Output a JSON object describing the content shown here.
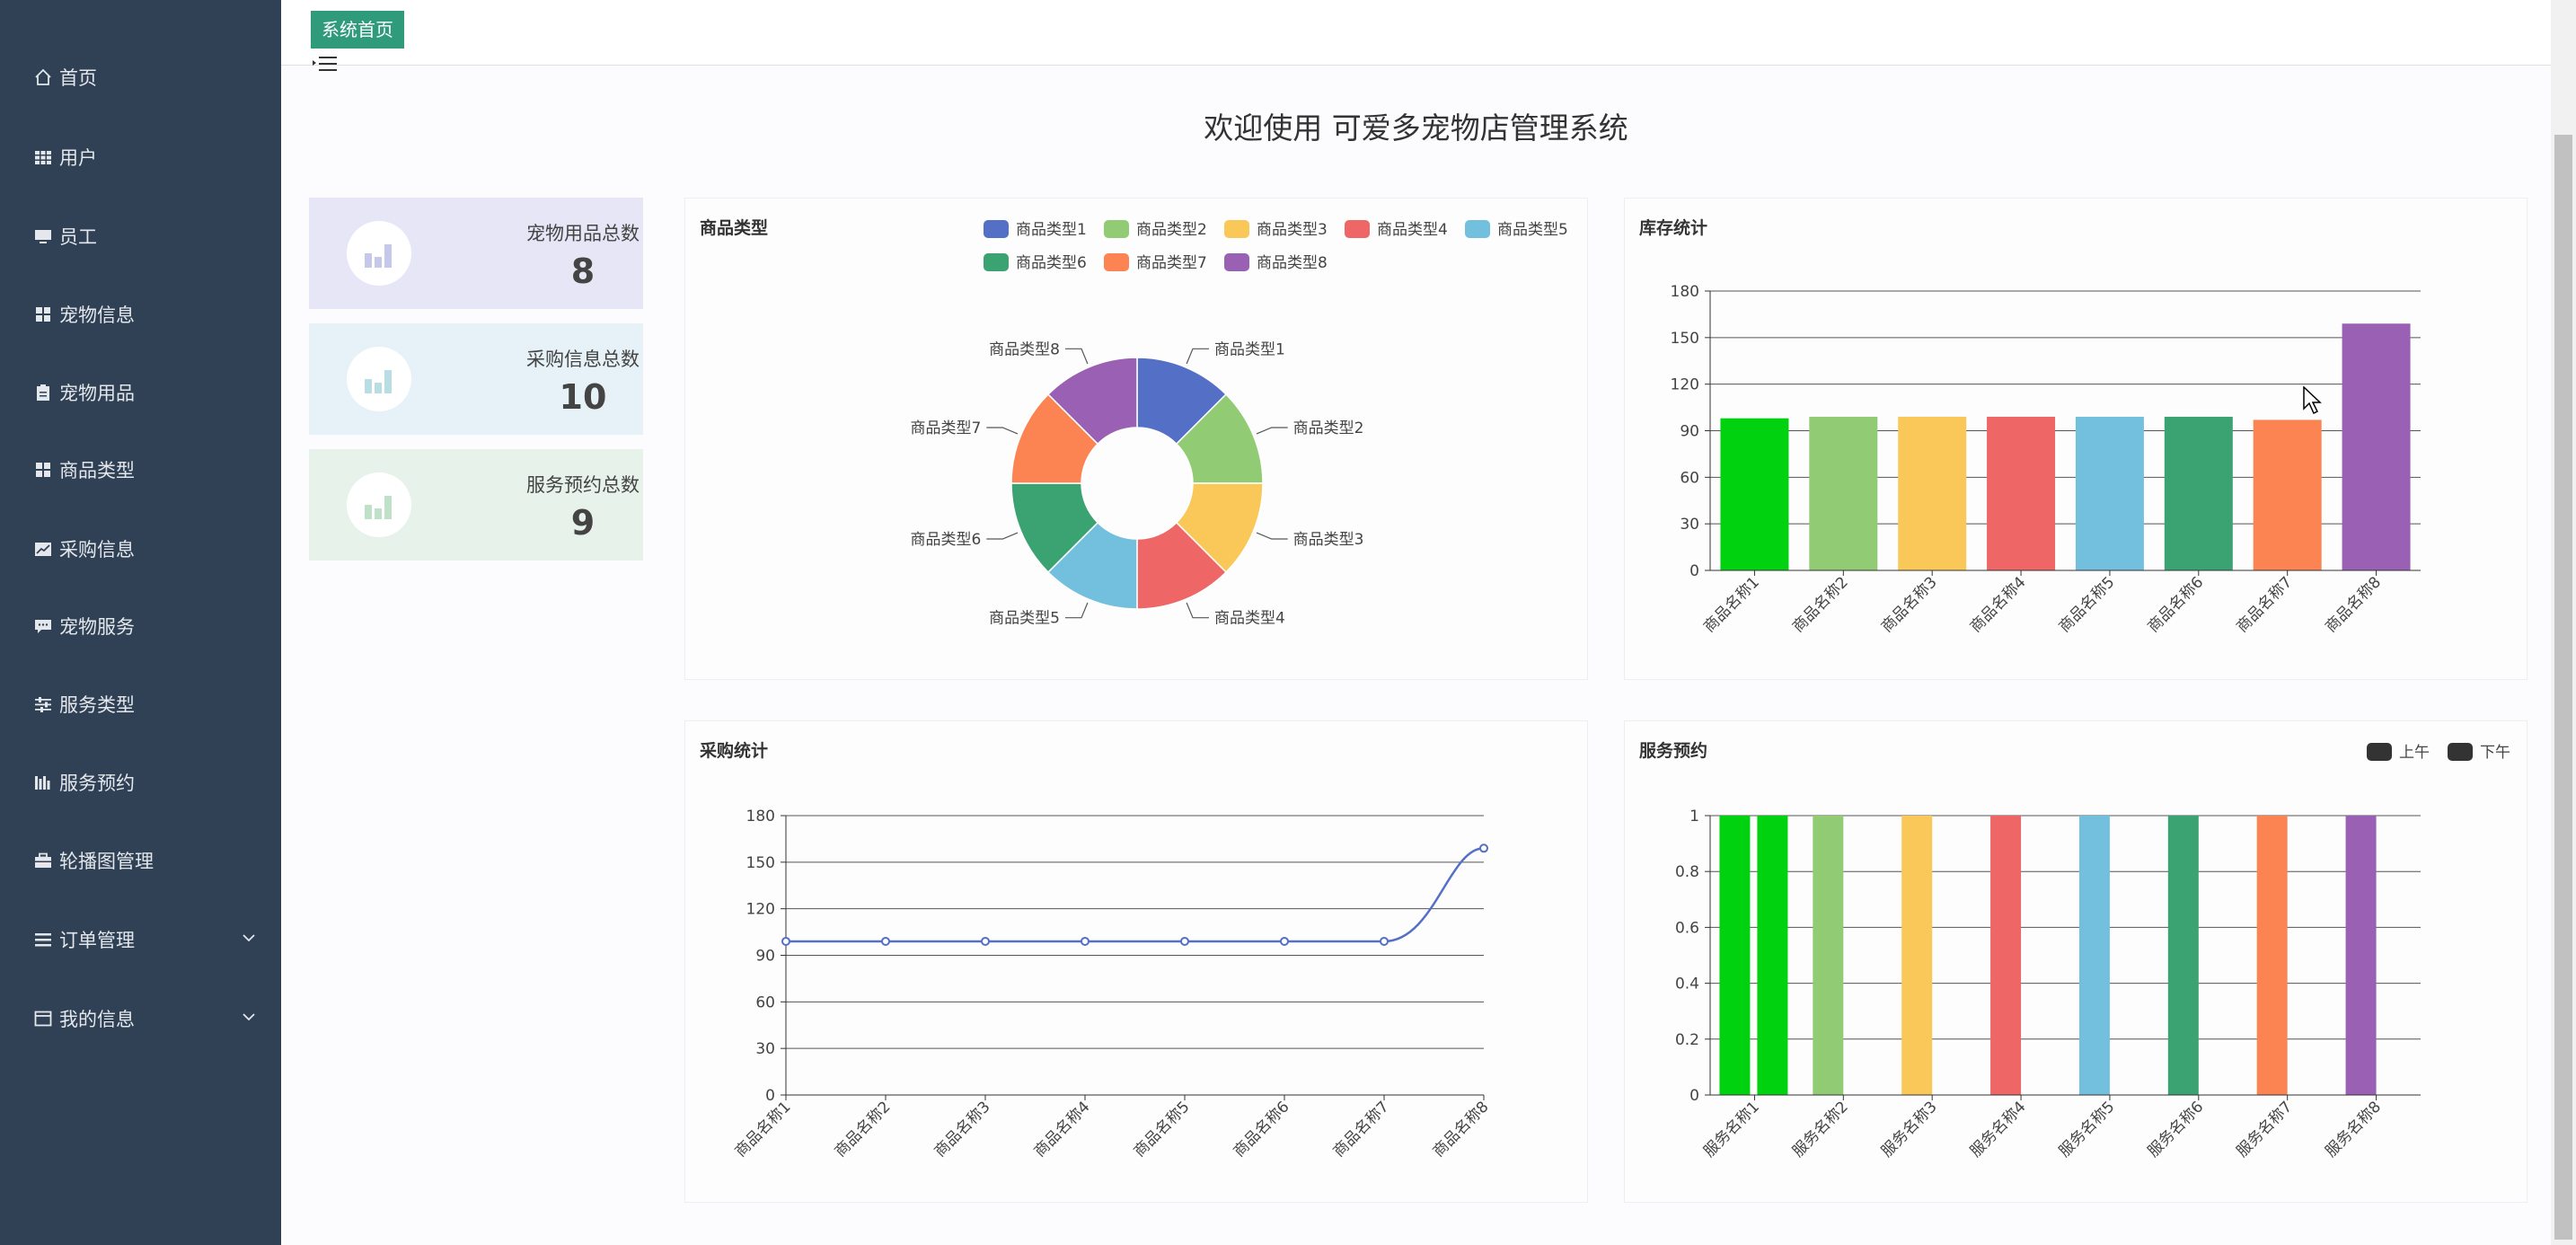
{
  "sidebar": {
    "items": [
      {
        "label": "首页",
        "icon": "home-icon"
      },
      {
        "label": "用户",
        "icon": "grid-icon"
      },
      {
        "label": "员工",
        "icon": "monitor-icon"
      },
      {
        "label": "宠物信息",
        "icon": "apps-icon"
      },
      {
        "label": "宠物用品",
        "icon": "clipboard-icon"
      },
      {
        "label": "商品类型",
        "icon": "apps-icon"
      },
      {
        "label": "采购信息",
        "icon": "chart-icon"
      },
      {
        "label": "宠物服务",
        "icon": "chat-icon"
      },
      {
        "label": "服务类型",
        "icon": "sliders-icon"
      },
      {
        "label": "服务预约",
        "icon": "bars-icon"
      },
      {
        "label": "轮播图管理",
        "icon": "briefcase-icon"
      },
      {
        "label": "订单管理",
        "icon": "menu-icon"
      },
      {
        "label": "我的信息",
        "icon": "window-icon"
      }
    ]
  },
  "header": {
    "tab_home": "系统首页"
  },
  "welcome": "欢迎使用 可爱多宠物店管理系统",
  "stats": [
    {
      "label": "宠物用品总数",
      "value": "8",
      "bg": "#e6e6f7",
      "icon_color": "#c6c8ea"
    },
    {
      "label": "采购信息总数",
      "value": "10",
      "bg": "#e6f2f7",
      "icon_color": "#b8dde3"
    },
    {
      "label": "服务预约总数",
      "value": "9",
      "bg": "#e7f2ea",
      "icon_color": "#bfe0c9"
    }
  ],
  "colors": {
    "palette": [
      "#5470c6",
      "#91cc75",
      "#fac858",
      "#ee6666",
      "#73c0de",
      "#3ba272",
      "#fc8452",
      "#9a60b4"
    ],
    "first_bar": "#00d20f"
  },
  "charts": {
    "pie_title": "商品类型",
    "stock_title": "库存统计",
    "purchase_title": "采购统计",
    "service_title": "服务预约"
  },
  "chart_data": [
    {
      "type": "pie",
      "title": "商品类型",
      "categories": [
        "商品类型1",
        "商品类型2",
        "商品类型3",
        "商品类型4",
        "商品类型5",
        "商品类型6",
        "商品类型7",
        "商品类型8"
      ],
      "values": [
        1,
        1,
        1,
        1,
        1,
        1,
        1,
        1
      ],
      "legend": "top-right"
    },
    {
      "type": "bar",
      "title": "库存统计",
      "categories": [
        "商品名称1",
        "商品名称2",
        "商品名称3",
        "商品名称4",
        "商品名称5",
        "商品名称6",
        "商品名称7",
        "商品名称8"
      ],
      "values": [
        98,
        99,
        99,
        99,
        99,
        99,
        97,
        159
      ],
      "ylim": [
        0,
        180
      ],
      "yticks": [
        0,
        30,
        60,
        90,
        120,
        150,
        180
      ]
    },
    {
      "type": "line",
      "title": "采购统计",
      "categories": [
        "商品名称1",
        "商品名称2",
        "商品名称3",
        "商品名称4",
        "商品名称5",
        "商品名称6",
        "商品名称7",
        "商品名称8"
      ],
      "values": [
        99,
        99,
        99,
        99,
        99,
        99,
        99,
        159
      ],
      "ylim": [
        0,
        180
      ],
      "yticks": [
        0,
        30,
        60,
        90,
        120,
        150,
        180
      ]
    },
    {
      "type": "bar",
      "title": "服务预约",
      "categories": [
        "服务名称1",
        "服务名称2",
        "服务名称3",
        "服务名称4",
        "服务名称5",
        "服务名称6",
        "服务名称7",
        "服务名称8"
      ],
      "series": [
        {
          "name": "上午",
          "values": [
            1,
            1,
            0,
            0,
            0,
            0,
            0,
            0
          ]
        },
        {
          "name": "下午",
          "values": [
            1,
            0,
            1,
            1,
            1,
            1,
            1,
            1
          ]
        }
      ],
      "ylim": [
        0,
        1
      ],
      "yticks": [
        "0",
        "0.2",
        "0.4",
        "0.6",
        "0.8",
        "1"
      ]
    }
  ]
}
